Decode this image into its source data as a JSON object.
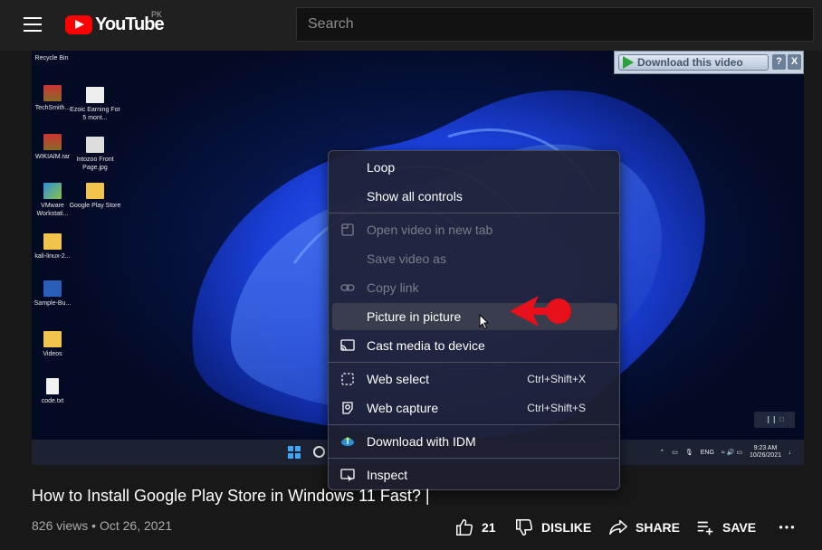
{
  "header": {
    "brand": "YouTube",
    "country_code": "PK",
    "search_placeholder": "Search"
  },
  "player": {
    "idm_button_label": "Download this video",
    "idm_help": "?",
    "idm_close": "X",
    "desktop_icons": [
      {
        "label": "Recycle Bin"
      },
      {
        "label": "TechSmith..."
      },
      {
        "label": "Ezoic Earning For 5 mont..."
      },
      {
        "label": "WIKIAIM.rar"
      },
      {
        "label": "Intozoo Front Page.jpg"
      },
      {
        "label": "VMware Workstati..."
      },
      {
        "label": "Google Play Store"
      },
      {
        "label": "kali-linux-2..."
      },
      {
        "label": "Sample-Bu..."
      },
      {
        "label": "Videos"
      },
      {
        "label": "code.txt"
      }
    ],
    "taskbar": {
      "lang": "ENG",
      "time": "9:23 AM",
      "date": "10/26/2021"
    }
  },
  "context_menu": {
    "items": [
      {
        "label": "Loop",
        "shortcut": "",
        "disabled": false,
        "icon": "none"
      },
      {
        "label": "Show all controls",
        "shortcut": "",
        "disabled": false,
        "icon": "none"
      },
      {
        "label": "Open video in new tab",
        "shortcut": "",
        "disabled": true,
        "icon": "new-tab-icon"
      },
      {
        "label": "Save video as",
        "shortcut": "",
        "disabled": true,
        "icon": "none"
      },
      {
        "label": "Copy link",
        "shortcut": "",
        "disabled": true,
        "icon": "link-icon"
      },
      {
        "label": "Picture in picture",
        "shortcut": "",
        "disabled": false,
        "icon": "none",
        "highlighted": true
      },
      {
        "label": "Cast media to device",
        "shortcut": "",
        "disabled": false,
        "icon": "cast-icon"
      },
      {
        "label": "Web select",
        "shortcut": "Ctrl+Shift+X",
        "disabled": false,
        "icon": "web-select-icon"
      },
      {
        "label": "Web capture",
        "shortcut": "Ctrl+Shift+S",
        "disabled": false,
        "icon": "web-capture-icon"
      },
      {
        "label": "Download with IDM",
        "shortcut": "",
        "disabled": false,
        "icon": "idm-icon"
      },
      {
        "label": "Inspect",
        "shortcut": "",
        "disabled": false,
        "icon": "inspect-icon"
      }
    ]
  },
  "video": {
    "title": "How to Install Google Play Store in Windows 11 Fast? |",
    "views": "826 views",
    "separator": "•",
    "date": "Oct 26, 2021"
  },
  "actions": {
    "like_count": "21",
    "dislike_label": "DISLIKE",
    "share_label": "SHARE",
    "save_label": "SAVE"
  },
  "colors": {
    "background": "#181818",
    "header": "#202020",
    "brand_red": "#ff0000",
    "annotation_arrow": "#e8101a"
  }
}
